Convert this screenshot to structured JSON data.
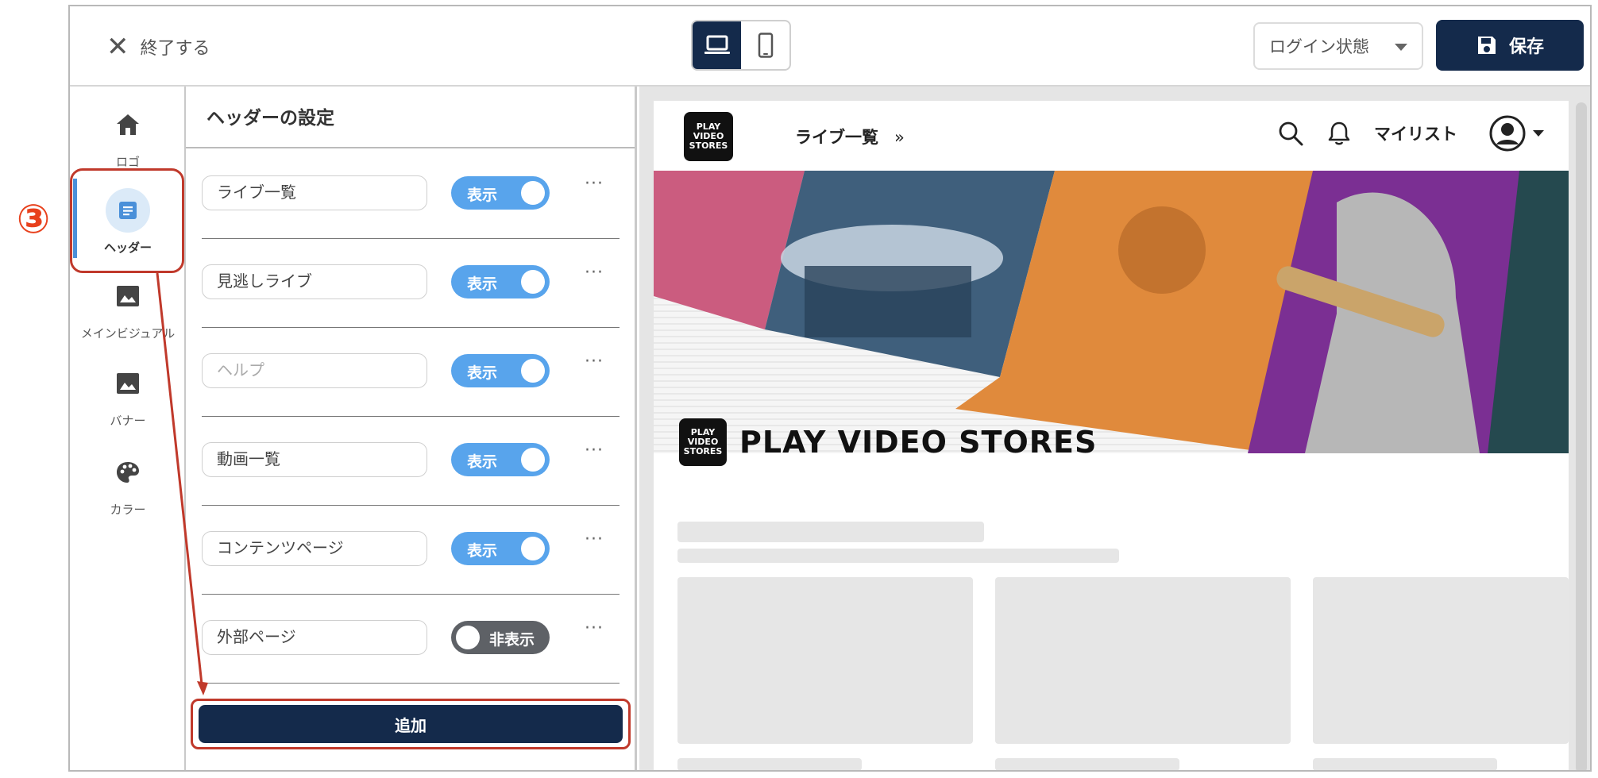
{
  "topbar": {
    "close_label": "終了する",
    "login_state": "ログイン状態",
    "save_label": "保存"
  },
  "leftnav": {
    "items": [
      {
        "label": "ロゴ",
        "icon": "home-icon"
      },
      {
        "label": "ヘッダー",
        "icon": "document-icon",
        "active": true
      },
      {
        "label": "メインビジュアル",
        "icon": "image-icon"
      },
      {
        "label": "バナー",
        "icon": "image-icon"
      },
      {
        "label": "カラー",
        "icon": "palette-icon"
      }
    ]
  },
  "panel": {
    "title": "ヘッダーの設定",
    "rows": [
      {
        "value": "ライブ一覧",
        "state": "表示"
      },
      {
        "value": "見逃しライブ",
        "state": "表示"
      },
      {
        "value": "ヘルプ",
        "placeholder": true,
        "state": "表示"
      },
      {
        "value": "動画一覧",
        "state": "表示"
      },
      {
        "value": "コンテンツページ",
        "state": "表示"
      },
      {
        "value": "外部ページ",
        "state": "非表示"
      }
    ],
    "more": "···",
    "add_label": "追加"
  },
  "preview": {
    "logo_text_1": "PLAY",
    "logo_text_2": "VIDEO",
    "logo_text_3": "STORES",
    "nav_item": "ライブ一覧",
    "nav_chevron": "»",
    "mylist": "マイリスト",
    "brand_name": "PLAY VIDEO STORES"
  },
  "annotation": {
    "step": "③"
  },
  "colors": {
    "navy": "#142a4b",
    "toggle_on": "#58a4ec",
    "toggle_off": "#5e6166",
    "annotation_red": "#c0392b"
  }
}
